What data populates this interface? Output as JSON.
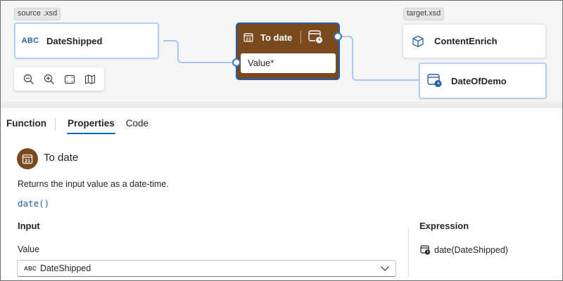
{
  "canvas": {
    "source_label": "source .xsd",
    "target_label": "target.xsd",
    "source_node": {
      "type_badge": "ABC",
      "label": "DateShipped",
      "icon": "text-type-icon"
    },
    "function_node": {
      "title": "To date",
      "input_label": "Value*",
      "header_icon": "calendar-icon",
      "output_icon": "calendar-clock-icon",
      "color": "#7a4a1e"
    },
    "target_nodes": [
      {
        "label": "ContentEnrich",
        "icon": "cube-icon"
      },
      {
        "label": "DateOfDemo",
        "icon": "calendar-clock-icon"
      }
    ],
    "zoom_controls": [
      "zoom-out-icon",
      "zoom-in-icon",
      "fit-to-screen-icon",
      "map-icon"
    ]
  },
  "tabs": [
    {
      "label": "Function",
      "active": false
    },
    {
      "label": "Properties",
      "active": true
    },
    {
      "label": "Code",
      "active": false
    }
  ],
  "properties": {
    "function_name": "To date",
    "description": "Returns the input value as a date-time.",
    "signature": "date()",
    "input_heading": "Input",
    "value_label": "Value",
    "value_selected": "DateShipped",
    "value_badge": "ABC",
    "expression_heading": "Expression",
    "expression_value": "date(DateShipped)"
  },
  "colors": {
    "accent": "#0f6cbd",
    "function_brown": "#7a4a1e",
    "wire": "#a9c7ec",
    "port_border": "#3a72b8"
  }
}
